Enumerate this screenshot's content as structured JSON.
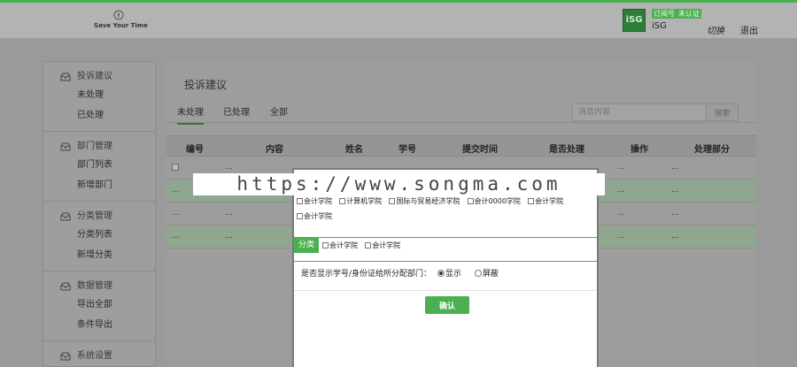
{
  "header": {
    "logo_text": "Save Your Time",
    "logo_icon": "compass-icon",
    "avatar_text": "iSG",
    "badge_1": "订阅号",
    "badge_2": "未认证",
    "username": "iSG",
    "switch_label": "切换",
    "logout_label": "退出"
  },
  "sidebar": {
    "groups": [
      {
        "title": "投诉建议",
        "icon": "inbox-icon",
        "items": [
          "未处理",
          "已处理"
        ]
      },
      {
        "title": "部门管理",
        "icon": "inbox-icon",
        "items": [
          "部门列表",
          "新增部门"
        ]
      },
      {
        "title": "分类管理",
        "icon": "inbox-icon",
        "items": [
          "分类列表",
          "新增分类"
        ]
      },
      {
        "title": "数据管理",
        "icon": "inbox-icon",
        "items": [
          "导出全部",
          "条件导出"
        ]
      },
      {
        "title": "系统设置",
        "icon": "inbox-icon",
        "items": []
      }
    ]
  },
  "main": {
    "title": "投诉建议",
    "tabs": [
      "未处理",
      "已处理",
      "全部"
    ],
    "active_tab": 0,
    "search_placeholder": "消息内容",
    "search_button": "搜索",
    "columns": [
      "编号",
      "内容",
      "姓名",
      "学号",
      "提交时间",
      "是否处理",
      "操作",
      "处理部分"
    ],
    "rows": [
      {
        "c0": "",
        "c1": "...",
        "c6": "...",
        "c7": "..."
      },
      {
        "c0": "...",
        "c1": "",
        "c6": "...",
        "c7": "..."
      },
      {
        "c0": "...",
        "c1": "...",
        "c6": "...",
        "c7": "..."
      },
      {
        "c0": "...",
        "c1": "...",
        "c6": "...",
        "c7": "..."
      }
    ]
  },
  "modal": {
    "departments": [
      "会计学院",
      "计算机学院",
      "国际与贸易经济学院",
      "会计0000学院",
      "会计学院",
      "会计学院"
    ],
    "category_label": "分类",
    "categories": [
      "会计学院",
      "会计学院"
    ],
    "show_question": "是否显示学号/身份证给所分配部门：",
    "show_yes": "显示",
    "show_no": "屏蔽",
    "confirm_label": "确认"
  },
  "watermark": "https://www.songma.com",
  "colors": {
    "accent": "#4caf50",
    "overlay": "#9a9a9a"
  }
}
